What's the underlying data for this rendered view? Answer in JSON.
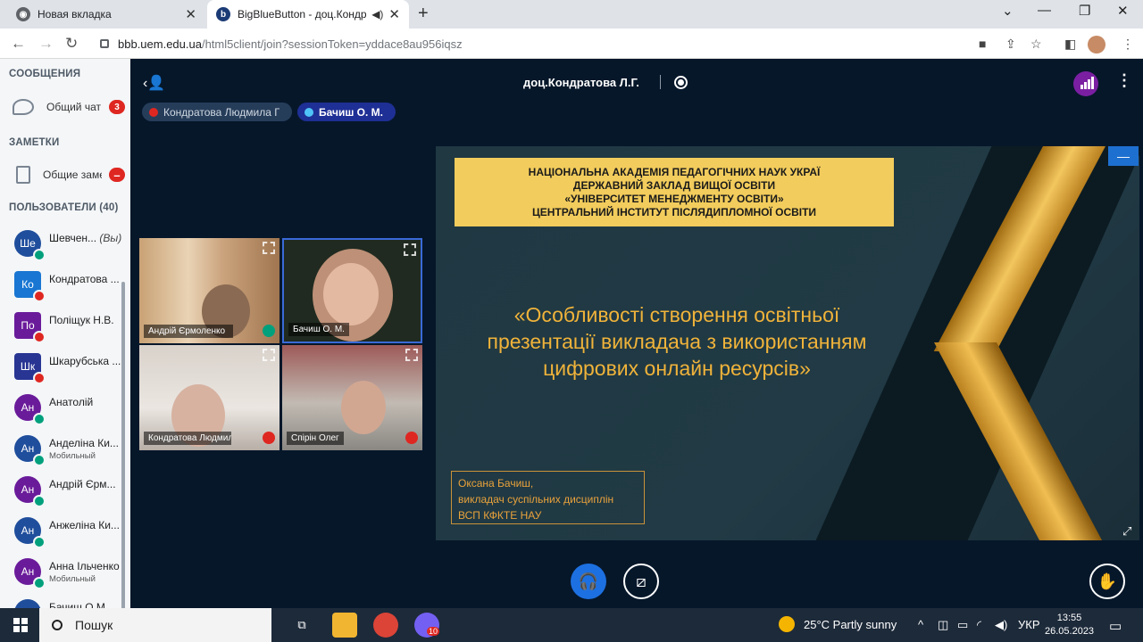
{
  "browser": {
    "tabs": [
      {
        "title": "Новая вкладка"
      },
      {
        "title": "BigBlueButton - доц.Кондратова Л.Г."
      }
    ],
    "url_host": "bbb.uem.edu.ua",
    "url_path": "/html5client/join?sessionToken=yddace8au956iqsz"
  },
  "sidebar": {
    "messages_header": "СООБЩЕНИЯ",
    "public_chat_label": "Общий чат",
    "public_chat_count": "3",
    "notes_header": "ЗАМЕТКИ",
    "shared_notes_label": "Общие заметки",
    "users_header": "ПОЛЬЗОВАТЕЛИ (40)",
    "users": [
      {
        "initials": "Ше",
        "name": "Шевчен...",
        "you": "(Вы)",
        "sub": "",
        "color": "#1f4e9c",
        "status": "hp",
        "square": false
      },
      {
        "initials": "Ко",
        "name": "Кондратова ...",
        "you": "",
        "sub": "",
        "color": "#1976d2",
        "status": "mu",
        "square": true
      },
      {
        "initials": "По",
        "name": "Поліщук Н.В.",
        "you": "",
        "sub": "",
        "color": "#6a1b9a",
        "status": "mu",
        "square": true
      },
      {
        "initials": "Шк",
        "name": "Шкарубська ...",
        "you": "",
        "sub": "",
        "color": "#283593",
        "status": "mu",
        "square": true
      },
      {
        "initials": "Ан",
        "name": "Анатолій",
        "you": "",
        "sub": "",
        "color": "#6a1b9a",
        "status": "hp",
        "square": false
      },
      {
        "initials": "Ан",
        "name": "Анделіна Ки...",
        "you": "",
        "sub": "Мобильный",
        "color": "#1f4e9c",
        "status": "hp",
        "square": false
      },
      {
        "initials": "Ан",
        "name": "Андрій Єрм...",
        "you": "",
        "sub": "",
        "color": "#6a1b9a",
        "status": "hp",
        "square": false
      },
      {
        "initials": "Ан",
        "name": "Анжеліна Ки...",
        "you": "",
        "sub": "",
        "color": "#1f4e9c",
        "status": "hp",
        "square": false
      },
      {
        "initials": "Ан",
        "name": "Анна Ільченко",
        "you": "",
        "sub": "Мобильный",
        "color": "#6a1b9a",
        "status": "hp",
        "square": false
      },
      {
        "initials": "Ба",
        "name": "Бачиш О.М.",
        "you": "",
        "sub": "",
        "color": "#1f4e9c",
        "status": "hp",
        "square": false
      }
    ]
  },
  "main": {
    "presenter_title": "доц.Кондратова Л.Г.",
    "talking": [
      {
        "name": "Кондратова Людмила Григорівна"
      },
      {
        "name": "Бачиш О. М."
      }
    ],
    "videos": [
      {
        "name": "Андрій Єрмоленко"
      },
      {
        "name": "Бачиш О. М."
      },
      {
        "name": "Кондратова Людмила"
      },
      {
        "name": "Спірін Олег"
      }
    ],
    "slide": {
      "header_lines": [
        "НАЦІОНАЛЬНА АКАДЕМІЯ ПЕДАГОГІЧНИХ НАУК УКРАЇ",
        "ДЕРЖАВНИЙ ЗАКЛАД ВИЩОЇ ОСВІТИ",
        "«УНІВЕРСИТЕТ МЕНЕДЖМЕНТУ ОСВІТИ»",
        "ЦЕНТРАЛЬНИЙ ІНСТИТУТ ПІСЛЯДИПЛОМНОЇ ОСВІТИ"
      ],
      "title_lines": [
        "«Особливості створення освітньої",
        "презентації викладача з використанням",
        "цифрових онлайн ресурсів»"
      ],
      "author_lines": [
        "Оксана Бачиш,",
        "викладач суспільних дисциплін",
        "ВСП КФКТЕ НАУ"
      ]
    }
  },
  "taskbar": {
    "search_label": "Пошук",
    "viber_badge": "10",
    "weather": "25°C  Partly sunny",
    "lang": "УКР",
    "time": "13:55",
    "date": "26.05.2023"
  },
  "colors": {
    "accent_blue": "#1d70e1",
    "slide_gold": "#f2cc5c",
    "danger": "#df2721"
  }
}
